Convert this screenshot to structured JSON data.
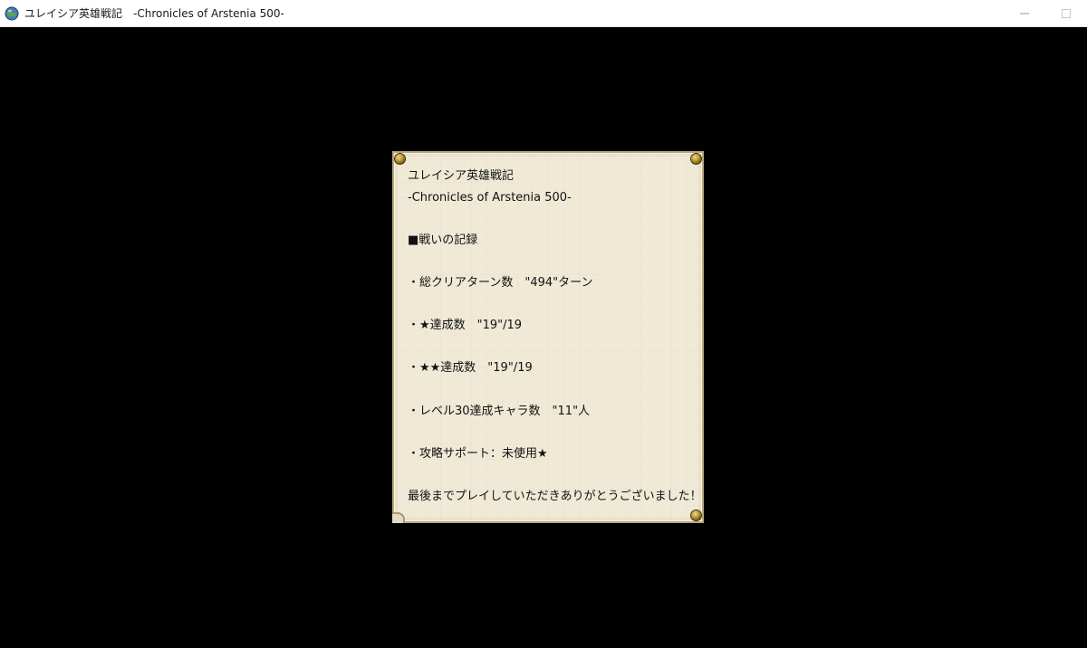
{
  "window": {
    "title": "ユレイシア英雄戦記　-Chronicles of Arstenia 500-",
    "icon": "globe-icon",
    "controls": {
      "minimize": "minimize-icon",
      "maximize": "maximize-icon"
    }
  },
  "record": {
    "lines": [
      "ユレイシア英雄戦記",
      "-Chronicles of Arstenia 500-",
      "",
      "■戦いの記録",
      "",
      "・総クリアターン数　\"494\"ターン",
      "",
      "・★達成数　\"19\"/19",
      "",
      "・★★達成数　\"19\"/19",
      "",
      "・レベル30達成キャラ数　\"11\"人",
      "",
      "・攻略サポート：未使用★",
      "",
      "最後までプレイしていただきありがとうございました！"
    ]
  },
  "colors": {
    "background": "#000000",
    "scroll_paper": "#efe9d6",
    "scroll_border": "#b8a77a",
    "rivet": "#b4912f",
    "text": "#111111"
  }
}
